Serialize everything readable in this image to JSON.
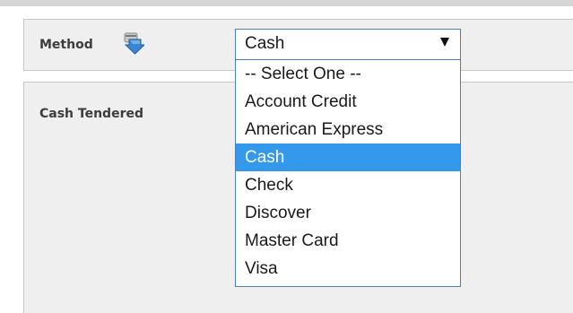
{
  "method": {
    "label": "Method",
    "icon": "payment-method-icon",
    "selected_value": "Cash"
  },
  "dropdown": {
    "options": [
      "-- Select One --",
      "Account Credit",
      "American Express",
      "Cash",
      "Check",
      "Discover",
      "Master Card",
      "Visa"
    ],
    "highlighted": "Cash"
  },
  "cash": {
    "label": "Cash Tendered"
  },
  "colors": {
    "highlight": "#3498eb",
    "select_border": "#4a7fc0",
    "panel_bg": "#efefef"
  }
}
